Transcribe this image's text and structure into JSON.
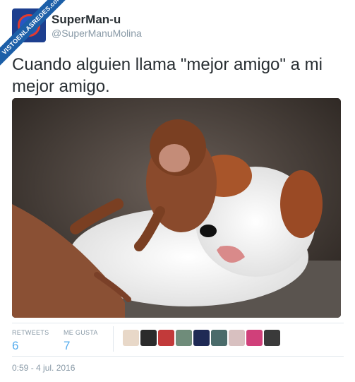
{
  "watermark": "VISTOENLASREDES.com",
  "user": {
    "display_name": "SuperMan-u",
    "handle": "@SuperManuMolina"
  },
  "tweet": {
    "text": "Cuando alguien llama \"mejor amigo\" a mi mejor amigo."
  },
  "stats": {
    "retweets_label": "RETWEETS",
    "retweets_value": "6",
    "likes_label": "ME GUSTA",
    "likes_value": "7"
  },
  "likers": [
    {
      "color": "#e8d8c8"
    },
    {
      "color": "#2b2b2b"
    },
    {
      "color": "#c23a3a"
    },
    {
      "color": "#6f8c7a"
    },
    {
      "color": "#1f2a55"
    },
    {
      "color": "#4a6b6a"
    },
    {
      "color": "#d8c0c0"
    },
    {
      "color": "#d0407a"
    },
    {
      "color": "#3a3a3a"
    }
  ],
  "timestamp": "0:59 - 4 jul. 2016"
}
